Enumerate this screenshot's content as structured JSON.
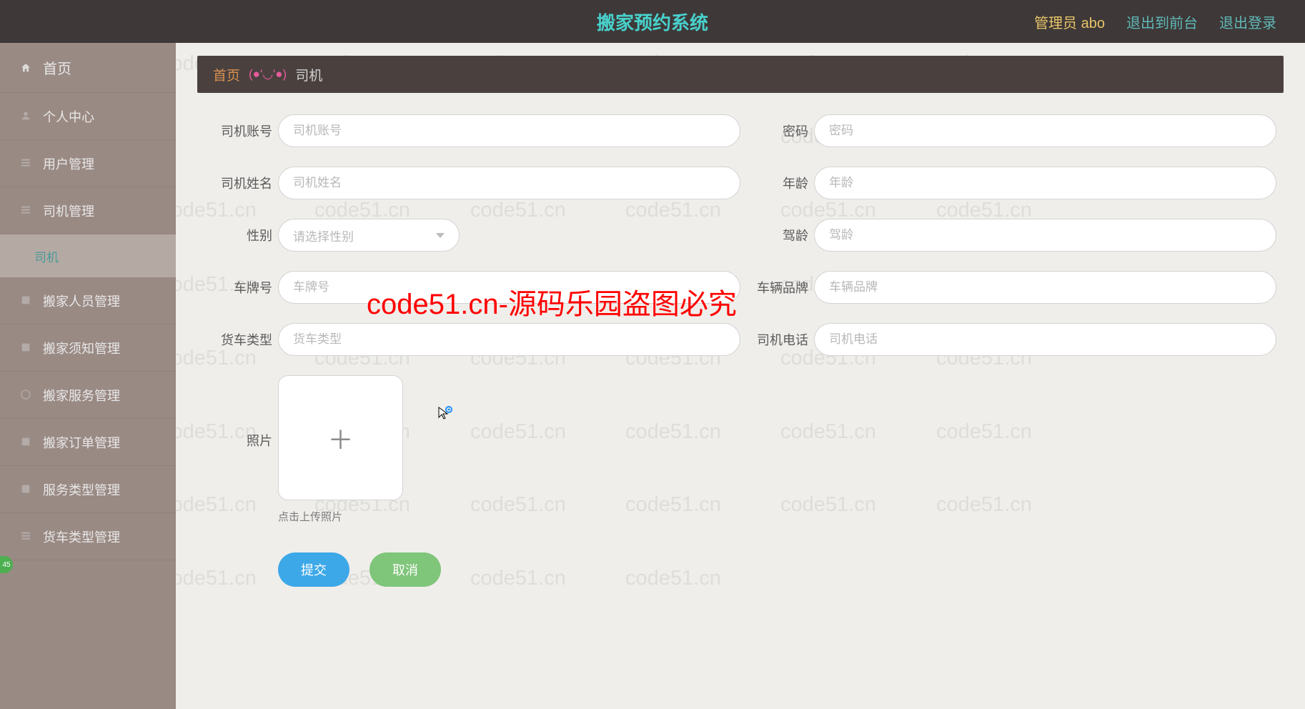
{
  "header": {
    "title": "搬家预约系统",
    "admin_label": "管理员 abo",
    "to_front_label": "退出到前台",
    "logout_label": "退出登录"
  },
  "sidebar": {
    "items": [
      {
        "label": "首页",
        "icon": "home-icon"
      },
      {
        "label": "个人中心",
        "icon": "user-icon"
      },
      {
        "label": "用户管理",
        "icon": "list-icon"
      },
      {
        "label": "司机管理",
        "icon": "driver-icon",
        "sub": [
          {
            "label": "司机"
          }
        ]
      },
      {
        "label": "搬家人员管理",
        "icon": "people-icon"
      },
      {
        "label": "搬家须知管理",
        "icon": "doc-icon"
      },
      {
        "label": "搬家服务管理",
        "icon": "service-icon"
      },
      {
        "label": "搬家订单管理",
        "icon": "order-icon"
      },
      {
        "label": "服务类型管理",
        "icon": "type-icon"
      },
      {
        "label": "货车类型管理",
        "icon": "truck-icon"
      }
    ]
  },
  "breadcrumb": {
    "home": "首页",
    "face": "(●'◡'●)",
    "current": "司机"
  },
  "form": {
    "driver_account": {
      "label": "司机账号",
      "placeholder": "司机账号"
    },
    "password": {
      "label": "密码",
      "placeholder": "密码"
    },
    "driver_name": {
      "label": "司机姓名",
      "placeholder": "司机姓名"
    },
    "age": {
      "label": "年龄",
      "placeholder": "年龄"
    },
    "gender": {
      "label": "性别",
      "placeholder": "请选择性别"
    },
    "drive_age": {
      "label": "驾龄",
      "placeholder": "驾龄"
    },
    "plate": {
      "label": "车牌号",
      "placeholder": "车牌号"
    },
    "brand": {
      "label": "车辆品牌",
      "placeholder": "车辆品牌"
    },
    "truck_type": {
      "label": "货车类型",
      "placeholder": "货车类型"
    },
    "phone": {
      "label": "司机电话",
      "placeholder": "司机电话"
    },
    "photo": {
      "label": "照片",
      "hint": "点击上传照片"
    }
  },
  "buttons": {
    "submit": "提交",
    "cancel": "取消"
  },
  "watermark": {
    "text": "code51.cn",
    "big": "code51.cn-源码乐园盗图必究"
  }
}
